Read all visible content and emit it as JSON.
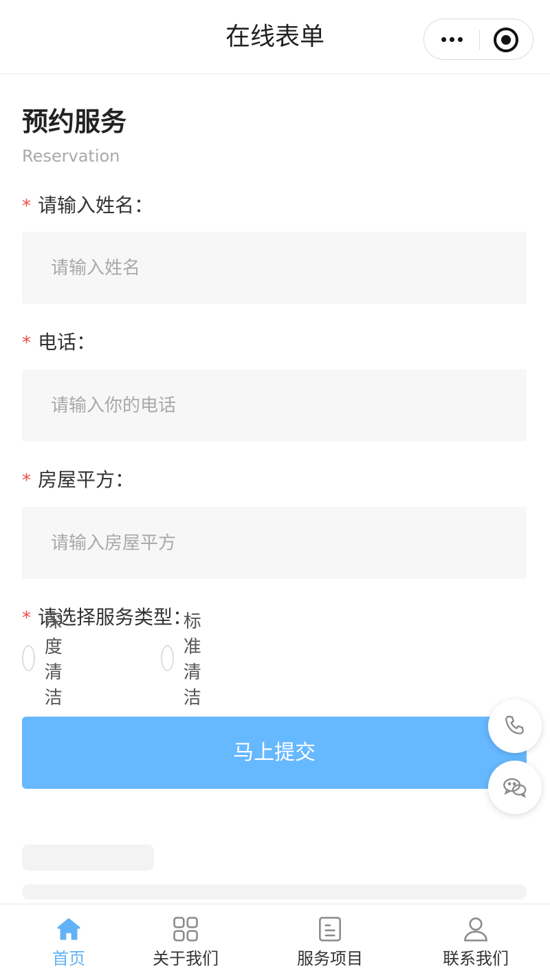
{
  "header": {
    "title": "在线表单"
  },
  "section": {
    "title": "预约服务",
    "subtitle": "Reservation"
  },
  "form": {
    "required_mark": "*",
    "name": {
      "label": "请输入姓名：",
      "placeholder": "请输入姓名"
    },
    "phone": {
      "label": "电话：",
      "placeholder": "请输入你的电话"
    },
    "area": {
      "label": "房屋平方：",
      "placeholder": "请输入房屋平方"
    },
    "service_type": {
      "label": "请选择服务类型：",
      "options": [
        "深度清洁",
        "标准清洁"
      ]
    },
    "submit_label": "马上提交"
  },
  "tabbar": {
    "items": [
      {
        "label": "首页",
        "icon": "home-icon",
        "active": true
      },
      {
        "label": "关于我们",
        "icon": "grid-icon",
        "active": false
      },
      {
        "label": "服务项目",
        "icon": "document-icon",
        "active": false
      },
      {
        "label": "联系我们",
        "icon": "user-icon",
        "active": false
      }
    ]
  },
  "floating": {
    "phone_icon": "phone-icon",
    "chat_icon": "chat-icon"
  },
  "colors": {
    "accent": "#62b2f7",
    "submit_bg": "#66b8ff",
    "required": "#f04a4a",
    "input_bg": "#f7f7f7"
  }
}
